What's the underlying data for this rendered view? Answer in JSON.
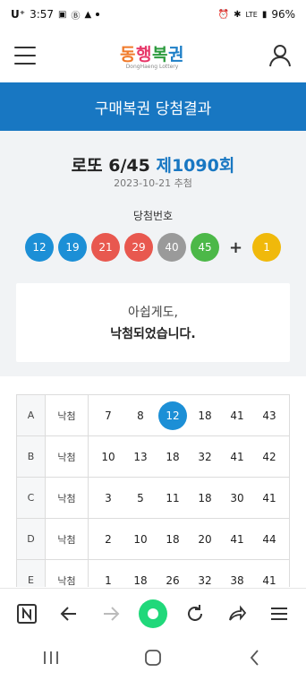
{
  "status_bar": {
    "carrier": "U⁺",
    "time": "3:57",
    "battery": "96%",
    "network": "LTE"
  },
  "header": {
    "logo_chars": [
      "동",
      "행",
      "복",
      "권"
    ],
    "logo_sub": "DongHaeng Lottery"
  },
  "title_bar": {
    "title": "구매복권 당첨결과"
  },
  "draw": {
    "game_name": "로또 6/45",
    "round": "제1090회",
    "date": "2023-10-21 추첨",
    "numbers_label": "당첨번호",
    "winning_numbers": [
      "12",
      "19",
      "21",
      "29",
      "40",
      "45"
    ],
    "plus": "+",
    "bonus": "1",
    "ball_colors": {
      "yellow": "#f0b90b",
      "blue": "#1c8fd6",
      "red": "#e8584f",
      "gray": "#9a9a9a",
      "green": "#4cb848"
    }
  },
  "message": {
    "line1": "아쉽게도,",
    "line2": "낙첨되었습니다."
  },
  "tickets": [
    {
      "letter": "A",
      "status": "낙첨",
      "numbers": [
        "7",
        "8",
        "12",
        "18",
        "41",
        "43"
      ],
      "hits": [
        false,
        false,
        true,
        false,
        false,
        false
      ]
    },
    {
      "letter": "B",
      "status": "낙첨",
      "numbers": [
        "10",
        "13",
        "18",
        "32",
        "41",
        "42"
      ],
      "hits": [
        false,
        false,
        false,
        false,
        false,
        false
      ]
    },
    {
      "letter": "C",
      "status": "낙첨",
      "numbers": [
        "3",
        "5",
        "11",
        "18",
        "30",
        "41"
      ],
      "hits": [
        false,
        false,
        false,
        false,
        false,
        false
      ]
    },
    {
      "letter": "D",
      "status": "낙첨",
      "numbers": [
        "2",
        "10",
        "18",
        "20",
        "41",
        "44"
      ],
      "hits": [
        false,
        false,
        false,
        false,
        false,
        false
      ]
    },
    {
      "letter": "E",
      "status": "낙첨",
      "numbers": [
        "1",
        "18",
        "26",
        "32",
        "38",
        "41"
      ],
      "hits": [
        false,
        false,
        false,
        false,
        false,
        false
      ]
    }
  ],
  "browser_bar": {
    "icons": [
      "naver-n-icon",
      "back-arrow-icon",
      "forward-arrow-icon",
      "home-circle-icon",
      "refresh-icon",
      "share-icon",
      "menu-icon"
    ]
  },
  "system_nav": {
    "icons": [
      "recents-icon",
      "home-icon",
      "back-icon"
    ]
  }
}
